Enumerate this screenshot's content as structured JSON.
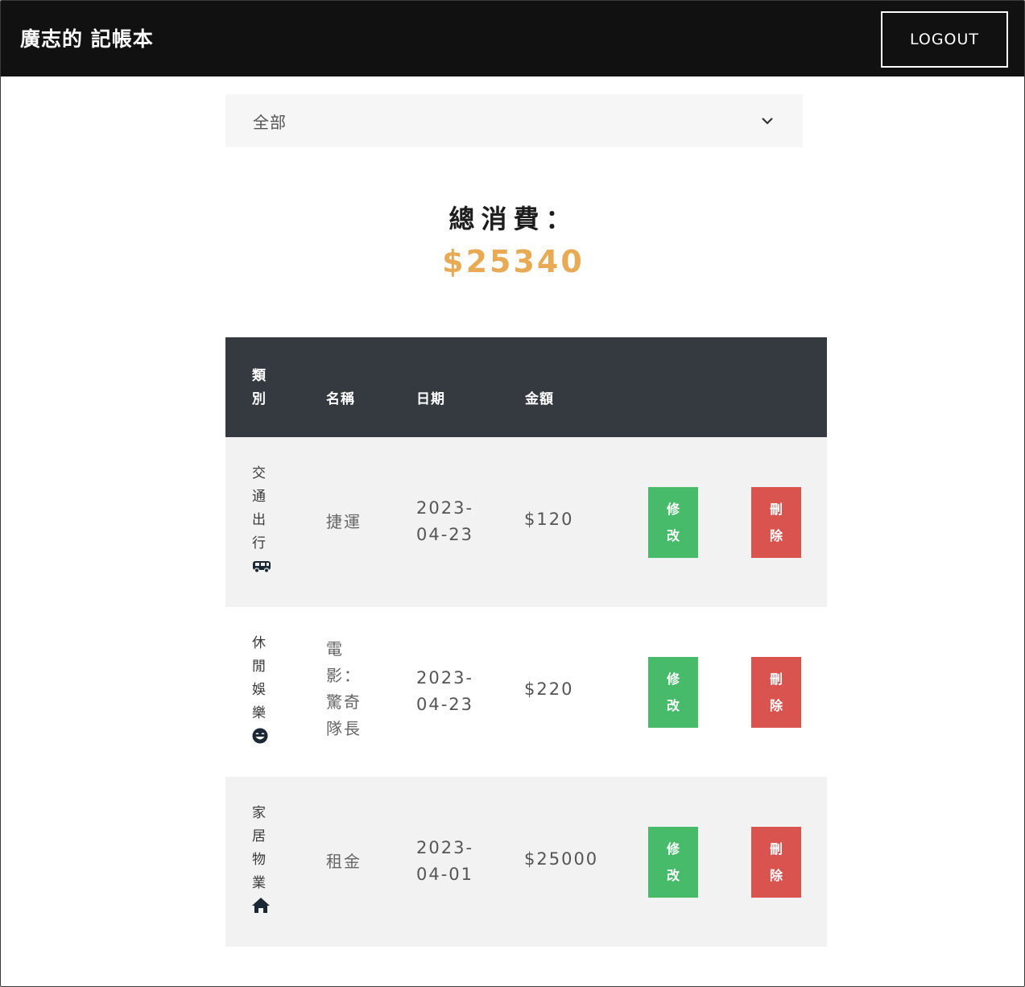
{
  "navbar": {
    "brand": "廣志的 記帳本",
    "logout_label": "LOGOUT"
  },
  "filter": {
    "selected": "全部"
  },
  "summary": {
    "label": "總消費：",
    "total": "$25340"
  },
  "colors": {
    "navbar_bg": "#111111",
    "table_header_bg": "#343a40",
    "total_accent": "#e8aa55",
    "edit_button": "#48bb6a",
    "delete_button": "#d9534f"
  },
  "table": {
    "headers": {
      "category_1": "類",
      "category_2": "別",
      "name": "名稱",
      "date": "日期",
      "amount": "金額"
    },
    "rows": [
      {
        "category": [
          "交",
          "通",
          "出",
          "行"
        ],
        "icon": "bus-icon",
        "name": "捷運",
        "date_1": "2023-",
        "date_2": "04-23",
        "amount": "$120",
        "edit_1": "修",
        "edit_2": "改",
        "delete_1": "刪",
        "delete_2": "除"
      },
      {
        "category": [
          "休",
          "閒",
          "娛",
          "樂"
        ],
        "icon": "smile-icon",
        "name_lines": [
          "電",
          "影：",
          "驚奇",
          "隊長"
        ],
        "date_1": "2023-",
        "date_2": "04-23",
        "amount": "$220",
        "edit_1": "修",
        "edit_2": "改",
        "delete_1": "刪",
        "delete_2": "除"
      },
      {
        "category": [
          "家",
          "居",
          "物",
          "業"
        ],
        "icon": "home-icon",
        "name": "租金",
        "date_1": "2023-",
        "date_2": "04-01",
        "amount": "$25000",
        "edit_1": "修",
        "edit_2": "改",
        "delete_1": "刪",
        "delete_2": "除"
      }
    ]
  }
}
